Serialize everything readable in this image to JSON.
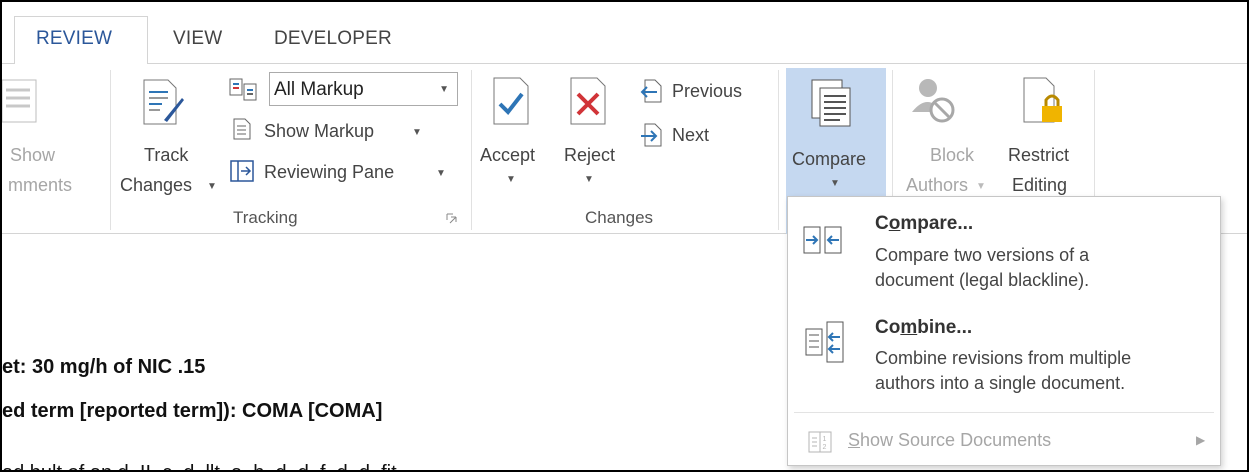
{
  "tabs": [
    "REVIEW",
    "VIEW",
    "DEVELOPER"
  ],
  "ribbon": {
    "show_comments": {
      "line1": "Show",
      "line2": "mments"
    },
    "track_changes": {
      "line1": "Track",
      "line2": "Changes"
    },
    "markup_dropdown": {
      "value": "All Markup"
    },
    "show_markup": "Show Markup",
    "reviewing_pane": "Reviewing Pane",
    "tracking_group": "Tracking",
    "accept": "Accept",
    "reject": "Reject",
    "previous": "Previous",
    "next": "Next",
    "changes_group": "Changes",
    "compare": "Compare",
    "block_authors": {
      "line1": "Block",
      "line2": "Authors"
    },
    "restrict_editing": {
      "line1": "Restrict",
      "line2": "Editing"
    }
  },
  "compare_menu": {
    "compare": {
      "title_pre": "C",
      "title_u": "o",
      "title_post": "mpare...",
      "desc1": "Compare two versions of a",
      "desc2": "document (legal blackline)."
    },
    "combine": {
      "title_pre": "Co",
      "title_u": "m",
      "title_post": "bine...",
      "desc1": "Combine revisions from multiple",
      "desc2": "authors into a single document."
    },
    "show_source": {
      "u": "S",
      "rest": "how Source Documents"
    }
  },
  "document": {
    "line1": "et: 30 mg/h of NIC .15",
    "line2": "ed term [reported term]): COMA [COMA]",
    "line3": "ad bult of an d. II. c. d. llt. a. h. d. d. f. d. d. fit"
  },
  "colors": {
    "accent": "#2b579a",
    "highlight": "#c5d8f0",
    "icon_blue": "#2e75b6",
    "reject_red": "#d13438",
    "lock_gold": "#f0b400"
  }
}
